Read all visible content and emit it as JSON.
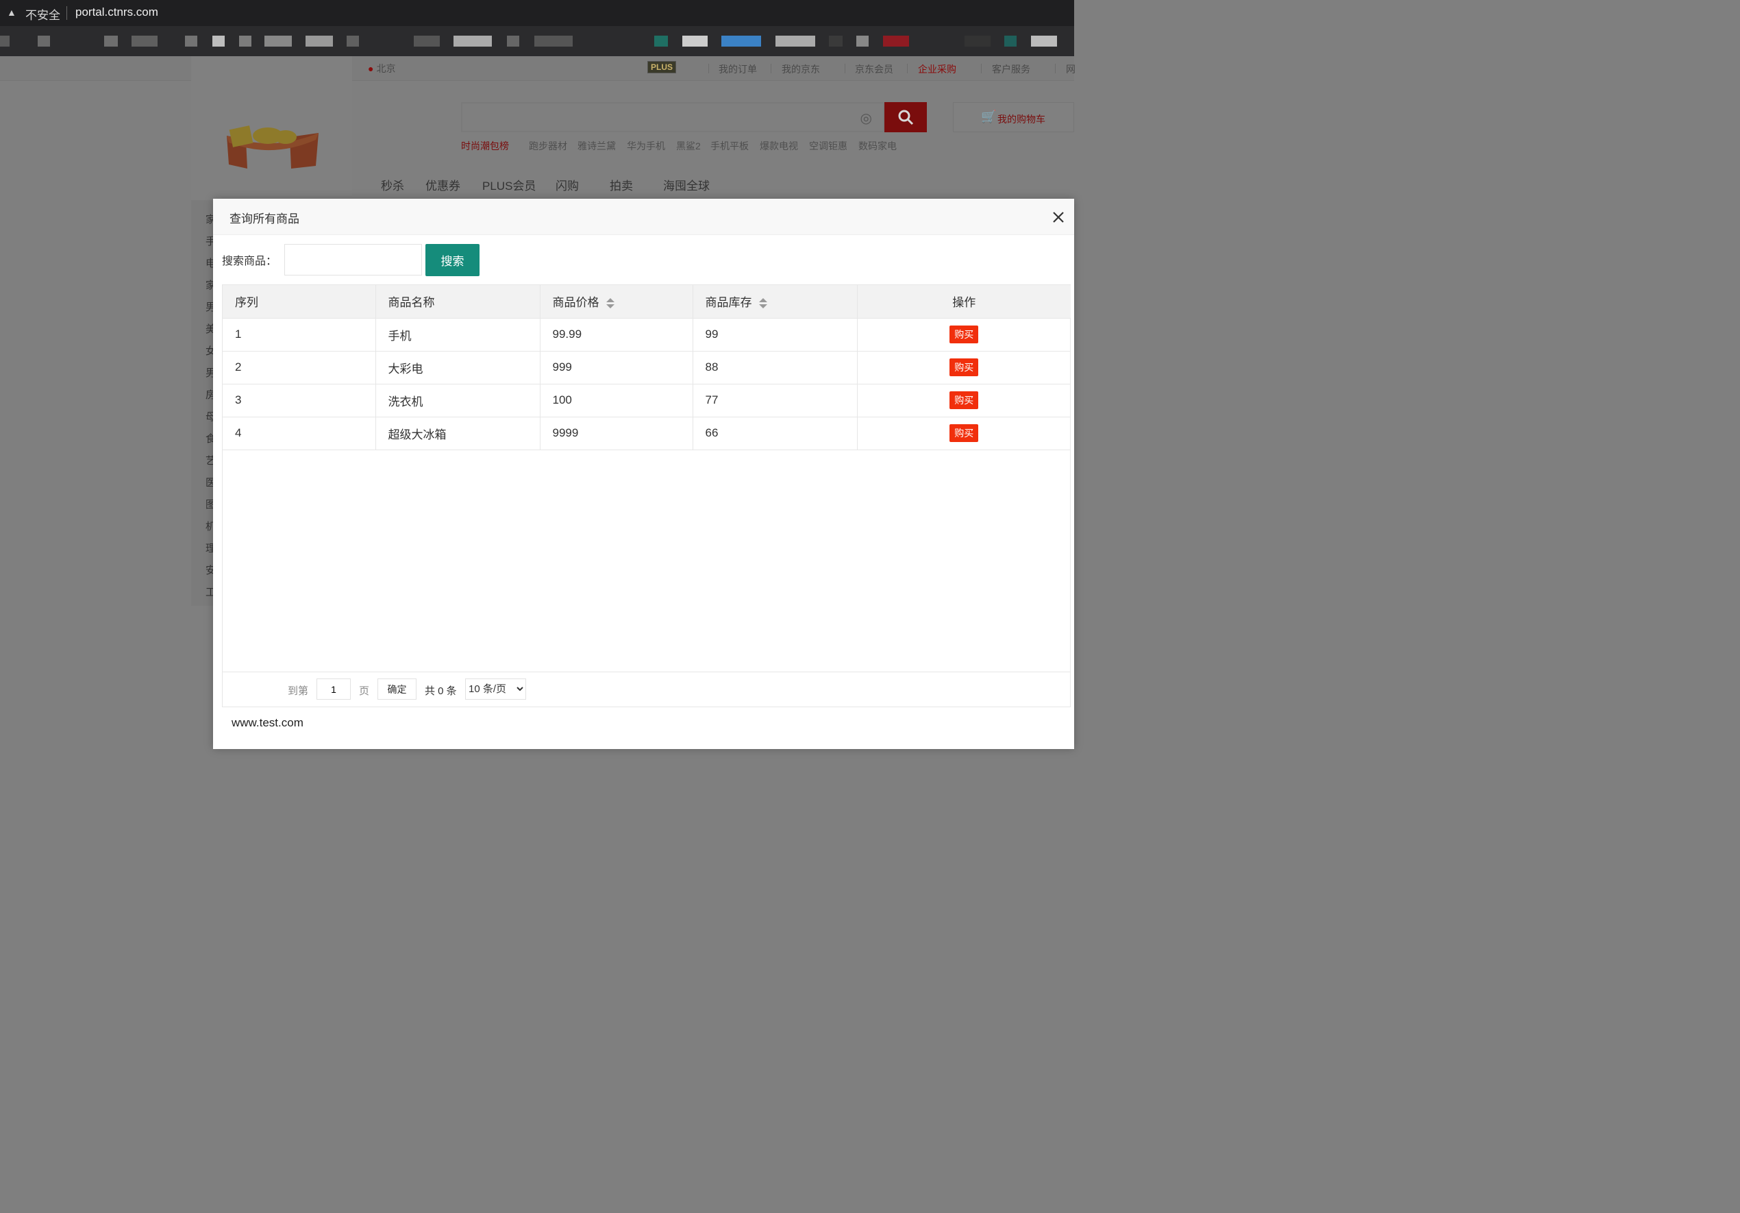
{
  "browser": {
    "security_label": "不安全",
    "url": "portal.ctnrs.com"
  },
  "portal": {
    "location": "北京",
    "plus_badge": "PLUS",
    "top_links": [
      "我的订单",
      "我的京东",
      "京东会员",
      "企业采购",
      "客户服务",
      "网"
    ],
    "cart_label": "我的购物车",
    "hot_words_red": "时尚潮包榜",
    "hot_words": [
      "跑步器材",
      "雅诗兰黛",
      "华为手机",
      "黑鲨2",
      "手机平板",
      "爆款电视",
      "空调钜惠",
      "数码家电"
    ],
    "category_nav": [
      "秒杀",
      "优惠券",
      "PLUS会员",
      "闪购",
      "拍卖",
      "海囤全球"
    ],
    "left_categories": [
      "家",
      "手",
      "电",
      "家",
      "男",
      "美",
      "女",
      "男",
      "房",
      "母",
      "食",
      "艺",
      "医",
      "图",
      "机",
      "理",
      "安",
      "工"
    ]
  },
  "modal": {
    "title": "查询所有商品",
    "search_label": "搜索商品：",
    "search_value": "",
    "search_button": "搜索",
    "table": {
      "headers": [
        "序列",
        "商品名称",
        "商品价格",
        "商品库存",
        "操作"
      ],
      "rows": [
        {
          "index": "1",
          "name": "手机",
          "price": "99.99",
          "stock": "99",
          "action": "购买"
        },
        {
          "index": "2",
          "name": "大彩电",
          "price": "999",
          "stock": "88",
          "action": "购买"
        },
        {
          "index": "3",
          "name": "洗衣机",
          "price": "100",
          "stock": "77",
          "action": "购买"
        },
        {
          "index": "4",
          "name": "超级大冰箱",
          "price": "9999",
          "stock": "66",
          "action": "购买"
        }
      ]
    },
    "pager": {
      "goto_label": "到第",
      "page_value": "1",
      "page_unit": "页",
      "confirm": "确定",
      "total": "共 0 条",
      "page_size": "10 条/页"
    },
    "footer": "www.test.com"
  },
  "colors": {
    "search_button": "#158c7b",
    "buy_button": "#f12f0c",
    "brand_red": "#e1251b"
  }
}
